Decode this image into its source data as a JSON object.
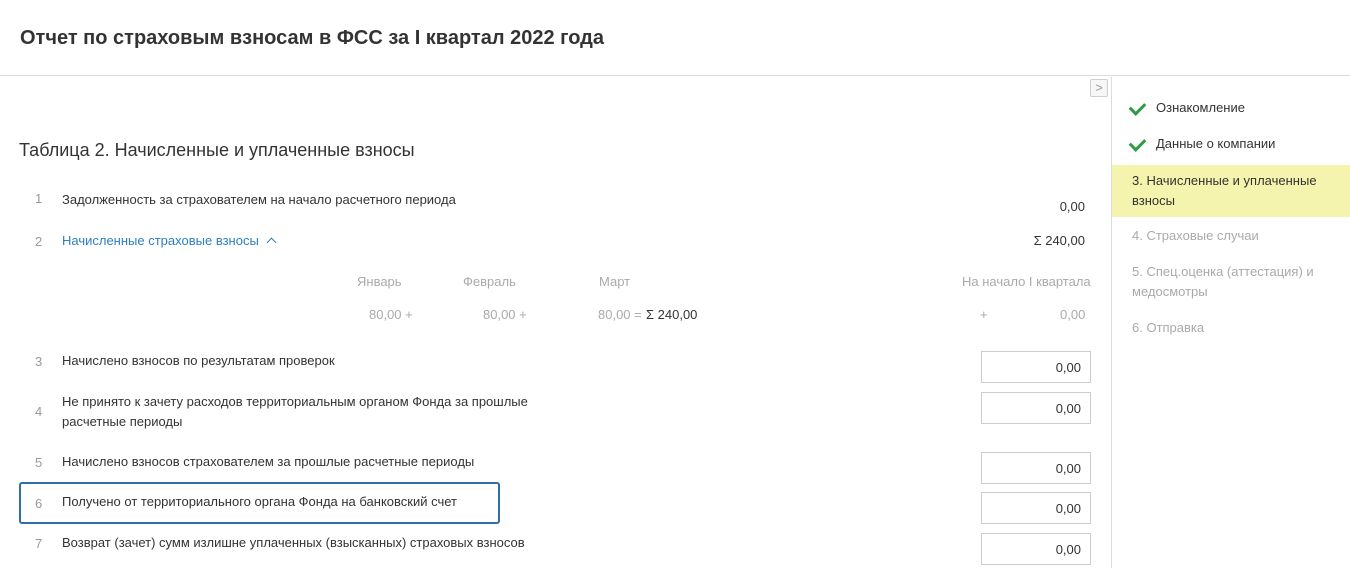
{
  "header": {
    "title": "Отчет по страховым взносам в ФСС за I квартал 2022 года"
  },
  "collapse_button": {
    "label": ">"
  },
  "section": {
    "title": "Таблица 2. Начисленные и уплаченные взносы"
  },
  "rows": [
    {
      "num": "1",
      "label": "Задолженность за страхователем на начало расчетного периода",
      "value": "0,00"
    },
    {
      "num": "2",
      "label": "Начисленные страховые взносы",
      "toggle": "^",
      "value": "Σ  240,00"
    },
    {
      "num": "3",
      "label": "Начислено взносов по результатам проверок",
      "value": "0,00"
    },
    {
      "num": "4",
      "label_line1": "Не принято к зачету расходов территориальным органом Фонда за прошлые",
      "label_line2": "расчетные периоды",
      "value": "0,00"
    },
    {
      "num": "5",
      "label": "Начислено взносов страхователем за прошлые расчетные периоды",
      "value": "0,00"
    },
    {
      "num": "6",
      "label": "Получено от территориального органа Фонда на банковский счет",
      "value": "0,00"
    },
    {
      "num": "7",
      "label": "Возврат (зачет) сумм излишне уплаченных (взысканных) страховых взносов",
      "value": "0,00"
    }
  ],
  "months": {
    "jan_label": "Январь",
    "feb_label": "Февраль",
    "mar_label": "Март",
    "start_label": "На начало I квартала",
    "jan_value": "80,00 +",
    "feb_value": "80,00 +",
    "mar_value": "80,00 =",
    "sum": "Σ  240,00",
    "start_plus": "+",
    "start_value": "0,00"
  },
  "sidebar": {
    "steps": [
      {
        "label": "Ознакомление",
        "state": "done"
      },
      {
        "label": "Данные о компании",
        "state": "done"
      },
      {
        "label": "3.  Начисленные и уплаченные взносы",
        "state": "active"
      },
      {
        "label": "4.  Страховые случаи",
        "state": "pending"
      },
      {
        "label": "5.  Спец.оценка (аттестация) и медосмотры",
        "state": "pending"
      },
      {
        "label": "6.  Отправка",
        "state": "pending"
      }
    ]
  },
  "colors": {
    "link": "#2d7fc1",
    "active_step_bg": "#f4f4ae",
    "check": "#2e9b45",
    "highlight_border": "#2f6ea7"
  }
}
